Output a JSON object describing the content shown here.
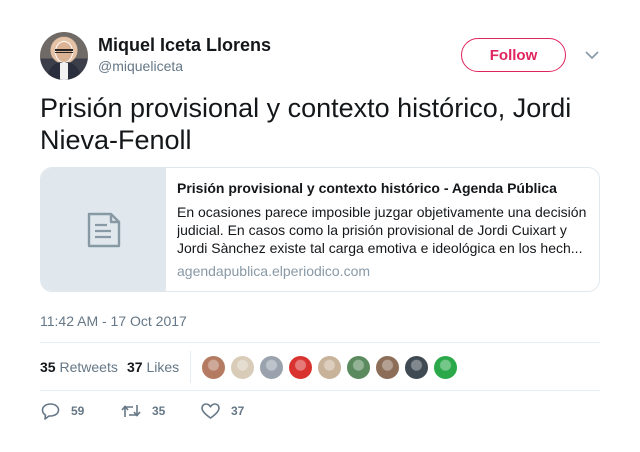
{
  "user": {
    "display_name": "Miquel Iceta Llorens",
    "handle": "@miqueliceta"
  },
  "follow_label": "Follow",
  "tweet_text": "Prisión provisional y contexto histórico, Jordi Nieva-Fenoll",
  "card": {
    "title": "Prisión provisional y contexto histórico - Agenda Pública",
    "description": "En ocasiones parece imposible juzgar objetivamente una decisión judicial. En casos como la prisión provisional de Jordi Cuixart y Jordi Sànchez existe tal carga emotiva e ideológica en los hech...",
    "domain": "agendapublica.elperiodico.com",
    "thumbnail_icon": "document-icon"
  },
  "timestamp": "11:42 AM - 17 Oct 2017",
  "stats": {
    "retweets_count": "35",
    "retweets_label": "Retweets",
    "likes_count": "37",
    "likes_label": "Likes"
  },
  "engaged_avatar_colors": [
    "#b47b62",
    "#d8cbb8",
    "#9aa3ad",
    "#d9332f",
    "#c9b29a",
    "#5a8a5e",
    "#8c6d58",
    "#3f4a52",
    "#2aa84a"
  ],
  "actions": {
    "replies": "59",
    "retweets": "35",
    "likes": "37"
  },
  "colors": {
    "follow_accent": "#e0245e",
    "secondary_text": "#657786",
    "border": "#e1e8ed"
  }
}
